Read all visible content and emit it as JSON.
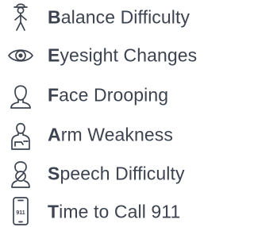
{
  "items": [
    {
      "icon": "person-balance-icon",
      "first_letter": "B",
      "rest": "alance Difficulty"
    },
    {
      "icon": "eye-icon",
      "first_letter": "E",
      "rest": "yesight Changes"
    },
    {
      "icon": "face-outline-icon",
      "first_letter": "F",
      "rest": "ace Drooping"
    },
    {
      "icon": "person-arm-icon",
      "first_letter": "A",
      "rest": "rm Weakness"
    },
    {
      "icon": "speech-head-icon",
      "first_letter": "S",
      "rest": "peech Difficulty"
    },
    {
      "icon": "phone-911-icon",
      "first_letter": "T",
      "rest": "ime to Call 911",
      "icon_text": "911"
    }
  ],
  "colors": {
    "text": "#3d4450",
    "background": "#ffffff"
  }
}
